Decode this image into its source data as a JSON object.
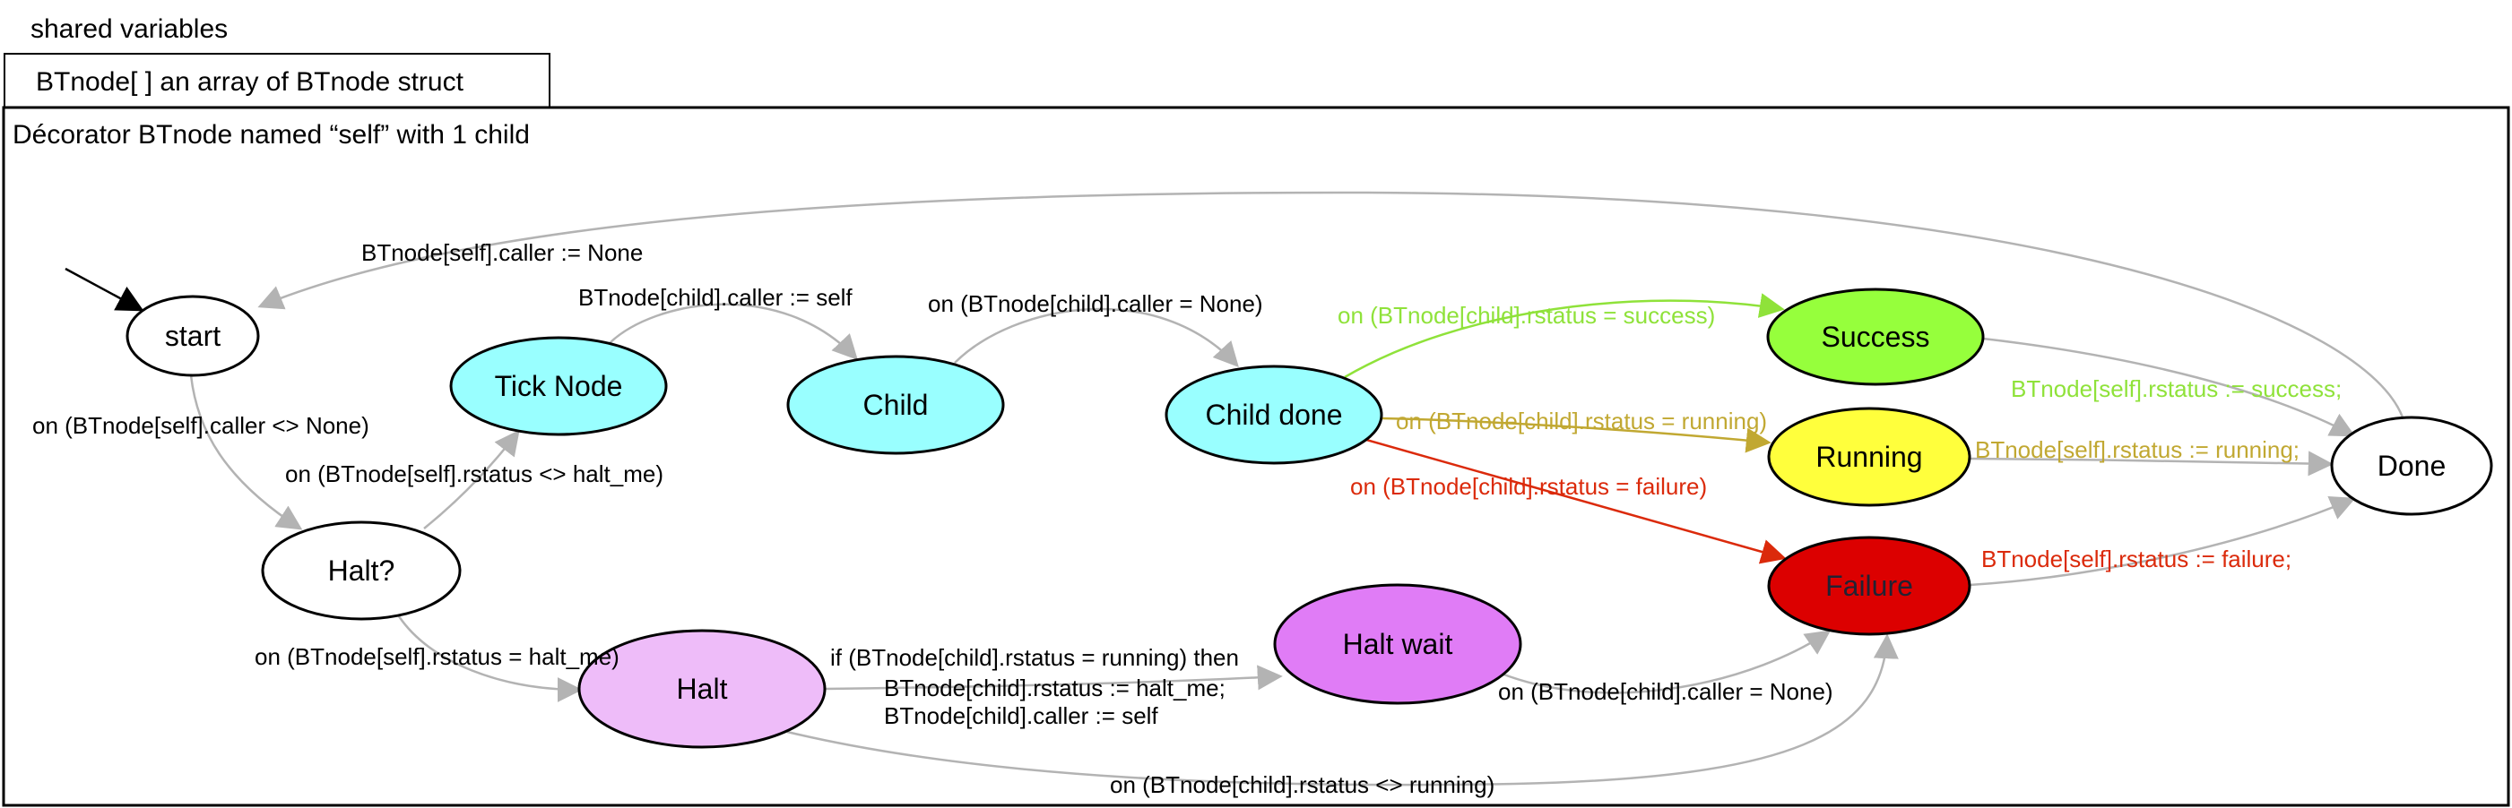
{
  "header": {
    "title": "shared variables",
    "struct_box": "BTnode[ ] an array of BTnode struct",
    "frame_title": "Décorator BTnode named “self” with 1 child"
  },
  "colors": {
    "edge_default": "#b3b3b3",
    "success": "#8fe23a",
    "running": "#c1a832",
    "failure": "#db2a0b",
    "node_cyan": "#99ffff",
    "node_success": "#96ff3c",
    "node_running": "#ffff3c",
    "node_failure": "#dc0000",
    "node_halt": "#eebcf9",
    "node_halt_wait": "#e07cf6",
    "node_white": "#ffffff"
  },
  "nodes": [
    {
      "id": "start",
      "label": "start",
      "fill": "node_white"
    },
    {
      "id": "tick",
      "label": "Tick Node",
      "fill": "node_cyan"
    },
    {
      "id": "child",
      "label": "Child",
      "fill": "node_cyan"
    },
    {
      "id": "childdone",
      "label": "Child done",
      "fill": "node_cyan"
    },
    {
      "id": "success",
      "label": "Success",
      "fill": "node_success"
    },
    {
      "id": "running",
      "label": "Running",
      "fill": "node_running"
    },
    {
      "id": "failure",
      "label": "Failure",
      "fill": "node_failure"
    },
    {
      "id": "done",
      "label": "Done",
      "fill": "node_white"
    },
    {
      "id": "haltq",
      "label": "Halt?",
      "fill": "node_white"
    },
    {
      "id": "halt",
      "label": "Halt",
      "fill": "node_halt"
    },
    {
      "id": "haltwait",
      "label": "Halt wait",
      "fill": "node_halt_wait"
    }
  ],
  "edges": [
    {
      "from": "done",
      "to": "start",
      "label": [
        "BTnode[self].caller := None"
      ],
      "color": "edge_default",
      "label_color": "default"
    },
    {
      "from": "start",
      "to": "haltq",
      "label": [
        "on (BTnode[self].caller <> None)"
      ],
      "color": "edge_default",
      "label_color": "default"
    },
    {
      "from": "haltq",
      "to": "tick",
      "label": [
        "on (BTnode[self].rstatus <> halt_me)"
      ],
      "color": "edge_default",
      "label_color": "default"
    },
    {
      "from": "tick",
      "to": "child",
      "label": [
        "BTnode[child].caller := self"
      ],
      "color": "edge_default",
      "label_color": "default"
    },
    {
      "from": "child",
      "to": "childdone",
      "label": [
        "on (BTnode[child].caller = None)"
      ],
      "color": "edge_default",
      "label_color": "default"
    },
    {
      "from": "childdone",
      "to": "success",
      "label": [
        "on (BTnode[child].rstatus = success)"
      ],
      "color": "success",
      "label_color": "success"
    },
    {
      "from": "childdone",
      "to": "running",
      "label": [
        "on (BTnode[child].rstatus = running)"
      ],
      "color": "running",
      "label_color": "running"
    },
    {
      "from": "childdone",
      "to": "failure",
      "label": [
        "on (BTnode[child].rstatus = failure)"
      ],
      "color": "failure",
      "label_color": "failure"
    },
    {
      "from": "success",
      "to": "done",
      "label": [
        "BTnode[self].rstatus := success;"
      ],
      "color": "edge_default",
      "label_color": "success"
    },
    {
      "from": "running",
      "to": "done",
      "label": [
        "BTnode[self].rstatus := running;"
      ],
      "color": "edge_default",
      "label_color": "running"
    },
    {
      "from": "failure",
      "to": "done",
      "label": [
        "BTnode[self].rstatus := failure;"
      ],
      "color": "edge_default",
      "label_color": "failure"
    },
    {
      "from": "haltq",
      "to": "halt",
      "label": [
        "on (BTnode[self].rstatus = halt_me)"
      ],
      "color": "edge_default",
      "label_color": "default"
    },
    {
      "from": "halt",
      "to": "haltwait",
      "label": [
        "if (BTnode[child].rstatus = running) then",
        "BTnode[child].rstatus := halt_me;",
        "BTnode[child].caller := self"
      ],
      "color": "edge_default",
      "label_color": "default"
    },
    {
      "from": "haltwait",
      "to": "failure",
      "label": [
        "on (BTnode[child].caller  = None)"
      ],
      "color": "edge_default",
      "label_color": "default"
    },
    {
      "from": "halt",
      "to": "failure",
      "label": [
        "on (BTnode[child].rstatus <> running)"
      ],
      "color": "edge_default",
      "label_color": "default"
    }
  ]
}
